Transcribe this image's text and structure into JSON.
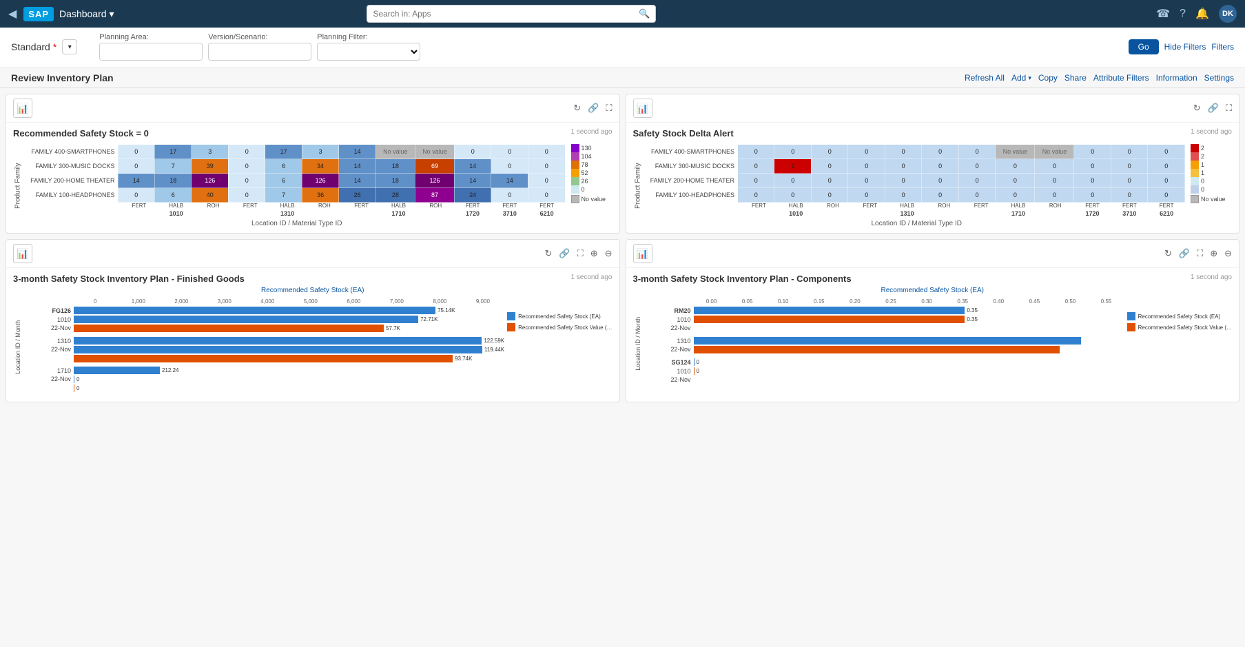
{
  "nav": {
    "back_icon": "◀",
    "sap_logo": "SAP",
    "title": "Dashboard",
    "chevron": "▾",
    "search_placeholder": "Search in: Apps",
    "search_icon": "🔍",
    "icons": [
      "☎",
      "?",
      "🔔"
    ],
    "avatar": "DK"
  },
  "filter_bar": {
    "standard_label": "Standard",
    "asterisk": "*",
    "dropdown_chevron": "▾",
    "planning_area_label": "Planning Area:",
    "version_scenario_label": "Version/Scenario:",
    "planning_filter_label": "Planning Filter:",
    "go_label": "Go",
    "hide_filters_label": "Hide Filters",
    "filters_label": "Filters"
  },
  "page_header": {
    "title": "Review Inventory Plan",
    "refresh_all": "Refresh All",
    "add": "Add",
    "add_chevron": "▾",
    "copy": "Copy",
    "share": "Share",
    "attribute_filters": "Attribute Filters",
    "information": "Information",
    "settings": "Settings"
  },
  "chart1": {
    "title": "Recommended Safety Stock = 0",
    "timestamp": "1 second ago",
    "chart_icon": "📊",
    "x_axis_label": "Location ID / Material Type ID",
    "y_axis_label": "Product Family",
    "row_labels": [
      "FAMILY 400-SMARTPHONES",
      "FAMILY 300-MUSIC DOCKS",
      "FAMILY 200-HOME THEATER",
      "FAMILY 100-HEADPHONES"
    ],
    "col_groups": [
      {
        "label": "1010",
        "cols": [
          "FERT",
          "HALB",
          "ROH"
        ]
      },
      {
        "label": "1310",
        "cols": [
          "FERT",
          "HALB",
          "ROH"
        ]
      },
      {
        "label": "1710",
        "cols": [
          "FERT",
          "HALB",
          "ROH"
        ]
      },
      {
        "label": "1720",
        "cols": [
          "FERT"
        ]
      },
      {
        "label": "3710",
        "cols": [
          "FERT"
        ]
      },
      {
        "label": "6210",
        "cols": [
          "FERT"
        ]
      }
    ],
    "data": [
      [
        0,
        17,
        3,
        0,
        17,
        3,
        14,
        "No value",
        "No value",
        0,
        0,
        0
      ],
      [
        0,
        7,
        39,
        0,
        6,
        34,
        14,
        18,
        69,
        14,
        0,
        0
      ],
      [
        14,
        18,
        126,
        0,
        6,
        126,
        14,
        18,
        126,
        14,
        14,
        0
      ],
      [
        0,
        6,
        40,
        0,
        7,
        36,
        26,
        28,
        87,
        24,
        0,
        0
      ]
    ],
    "colors": {
      "0": "#d0e0f0",
      "low": "#7ab5e0",
      "mid": "#f5a000",
      "high_orange": "#e05000",
      "high_green": "#00a000",
      "high_purple": "#8800cc",
      "no_value": "#b8b8b8"
    },
    "legend_values": [
      130,
      104,
      78,
      52,
      26,
      0
    ],
    "legend_colors": [
      "#8800cc",
      "#b040b0",
      "#e07000",
      "#f5a000",
      "#90c890",
      "#d0e8f0",
      "#b8b8b8"
    ]
  },
  "chart2": {
    "title": "Safety Stock Delta Alert",
    "timestamp": "1 second ago",
    "x_axis_label": "Location ID / Material Type ID",
    "y_axis_label": "Product Family",
    "row_labels": [
      "FAMILY 400-SMARTPHONES",
      "FAMILY 300-MUSIC DOCKS",
      "FAMILY 200-HOME THEATER",
      "FAMILY 100-HEADPHONES"
    ],
    "data": [
      [
        0,
        0,
        0,
        0,
        0,
        0,
        0,
        "No value",
        "No value",
        0,
        0,
        0
      ],
      [
        0,
        2,
        0,
        0,
        0,
        0,
        0,
        0,
        0,
        0,
        0,
        0
      ],
      [
        0,
        0,
        0,
        0,
        0,
        0,
        0,
        0,
        0,
        0,
        0,
        0
      ],
      [
        0,
        0,
        0,
        0,
        0,
        0,
        0,
        0,
        0,
        0,
        0,
        0
      ]
    ],
    "legend_values": [
      2,
      2,
      1,
      1,
      0,
      0
    ],
    "legend_colors": [
      "#cc0000",
      "#e05050",
      "#f5a000",
      "#f5c040",
      "#d0e8f0",
      "#c0d0e8",
      "#b8b8b8"
    ]
  },
  "chart3": {
    "title": "3-month Safety Stock Inventory Plan - Finished Goods",
    "timestamp": "1 second ago",
    "recommended_label": "Recommended Safety Stock (EA)",
    "x_axis_values": [
      "0",
      "1,000",
      "2,000",
      "3,000",
      "4,000",
      "5,000",
      "6,000",
      "7,000",
      "8,000",
      "9,000"
    ],
    "y_axis_label": "Location ID / Month",
    "legend": [
      {
        "label": "Recommended Safety Stock (EA)",
        "color": "#3080d0"
      },
      {
        "label": "Recommended Safety Stock Value (…",
        "color": "#e05000"
      }
    ],
    "groups": [
      {
        "id": "FG126",
        "location": "1010",
        "month": "22-Nov",
        "bars": [
          {
            "value": 75.14,
            "suffix": "K",
            "width_pct": 84,
            "color": "#3080d0"
          },
          {
            "value": 72.71,
            "suffix": "K",
            "width_pct": 80,
            "color": "#3080d0"
          },
          {
            "value": 57.7,
            "suffix": "K",
            "width_pct": 72,
            "color": "#e05000"
          }
        ]
      },
      {
        "id": "",
        "location": "1310",
        "month": "22-Nov",
        "bars": [
          {
            "value": 122.59,
            "suffix": "K",
            "width_pct": 100,
            "color": "#3080d0"
          },
          {
            "value": 119.44,
            "suffix": "K",
            "width_pct": 95,
            "color": "#3080d0"
          },
          {
            "value": 93.74,
            "suffix": "K",
            "width_pct": 88,
            "color": "#e05000"
          }
        ]
      },
      {
        "id": "",
        "location": "1710",
        "month": "22-Nov",
        "bars": [
          {
            "value": 212.24,
            "suffix": "",
            "width_pct": 20,
            "color": "#3080d0"
          },
          {
            "value": 0.0,
            "suffix": "",
            "width_pct": 0,
            "color": "#3080d0"
          },
          {
            "value": 0.0,
            "suffix": "",
            "width_pct": 0,
            "color": "#e05000"
          }
        ]
      }
    ]
  },
  "chart4": {
    "title": "3-month Safety Stock Inventory Plan - Components",
    "timestamp": "1 second ago",
    "recommended_label": "Recommended Safety Stock (EA)",
    "x_axis_values": [
      "0.00",
      "0.05",
      "0.10",
      "0.15",
      "0.20",
      "0.25",
      "0.30",
      "0.35",
      "0.40",
      "0.45",
      "0.50",
      "0.55"
    ],
    "y_axis_label": "Location ID / Month",
    "legend": [
      {
        "label": "Recommended Safety Stock (EA)",
        "color": "#3080d0"
      },
      {
        "label": "Recommended Safety Stock Value (…",
        "color": "#e05000"
      }
    ],
    "groups": [
      {
        "id": "RM20",
        "location": "1010",
        "month": "22-Nov",
        "bars": [
          {
            "value": 0.35,
            "suffix": "",
            "width_pct": 63,
            "color": "#3080d0"
          },
          {
            "value": 0.35,
            "suffix": "",
            "width_pct": 63,
            "color": "#e05000"
          }
        ]
      },
      {
        "id": "",
        "location": "1310",
        "month": "22-Nov",
        "bars": [
          {
            "value": null,
            "suffix": "",
            "width_pct": 90,
            "color": "#3080d0"
          },
          {
            "value": null,
            "suffix": "",
            "width_pct": 85,
            "color": "#e05000"
          }
        ]
      },
      {
        "id": "SG124",
        "location": "1010",
        "month": "22-Nov",
        "bars": [
          {
            "value": 0.0,
            "suffix": "",
            "width_pct": 0,
            "color": "#3080d0"
          },
          {
            "value": 0.0,
            "suffix": "",
            "width_pct": 0,
            "color": "#e05000"
          }
        ]
      }
    ]
  }
}
